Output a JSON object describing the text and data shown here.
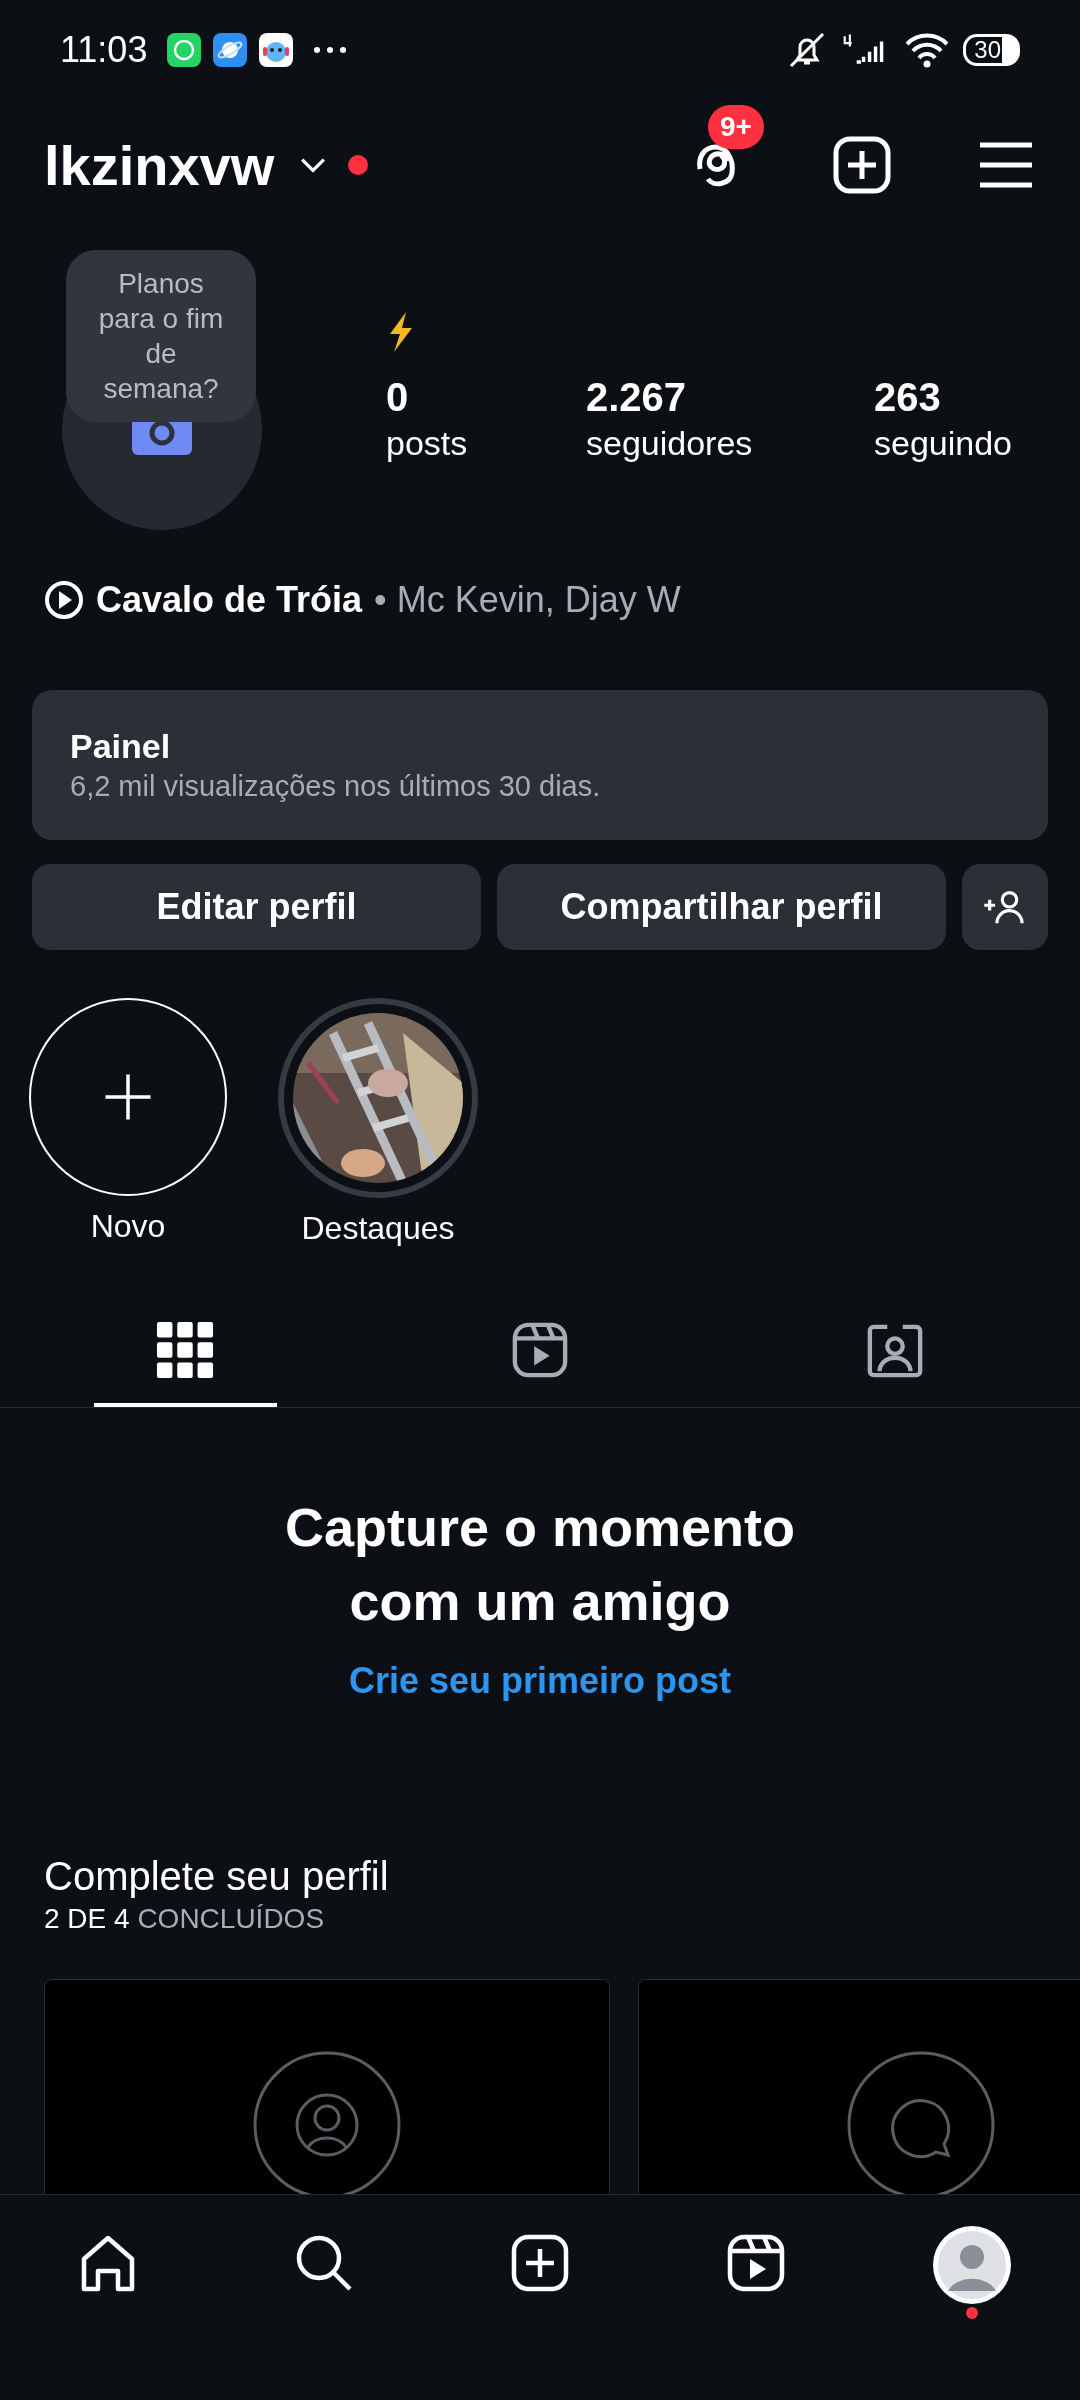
{
  "status_bar": {
    "time": "11:03",
    "battery": "30"
  },
  "header": {
    "username": "lkzinxvw",
    "unread_dot": true,
    "threads_badge": "9+"
  },
  "profile": {
    "tooltip": "Planos para o fim de semana?",
    "stats": [
      {
        "value": "0",
        "label": "posts"
      },
      {
        "value": "2.267",
        "label": "seguidores"
      },
      {
        "value": "263",
        "label": "seguindo"
      }
    ],
    "song": {
      "title": "Cavalo de Tróia",
      "artist": "• Mc Kevin, Djay W"
    }
  },
  "panel": {
    "title": "Painel",
    "subtitle": "6,2 mil visualizações nos últimos 30 dias."
  },
  "buttons": [
    "Editar perfil",
    "Compartilhar perfil"
  ],
  "highlights": [
    {
      "kind": "new",
      "label": "Novo"
    },
    {
      "kind": "picture",
      "label": "Destaques"
    }
  ],
  "tabs": [
    {
      "kind": "grid",
      "selected": true
    },
    {
      "kind": "reels",
      "selected": false
    },
    {
      "kind": "tagged",
      "selected": false
    }
  ],
  "empty": {
    "title": "Capture o momento com um amigo",
    "link": "Crie seu primeiro post"
  },
  "complete": {
    "title": "Complete seu perfil",
    "progress": "**2 DE 4** CONCLUÍDOS",
    "cards": [
      {
        "kind": "person"
      },
      {
        "kind": "chat"
      }
    ]
  },
  "bottom_nav": [
    {
      "kind": "home"
    },
    {
      "kind": "search"
    },
    {
      "kind": "create"
    },
    {
      "kind": "reels"
    },
    {
      "kind": "profile",
      "notification": true
    }
  ]
}
